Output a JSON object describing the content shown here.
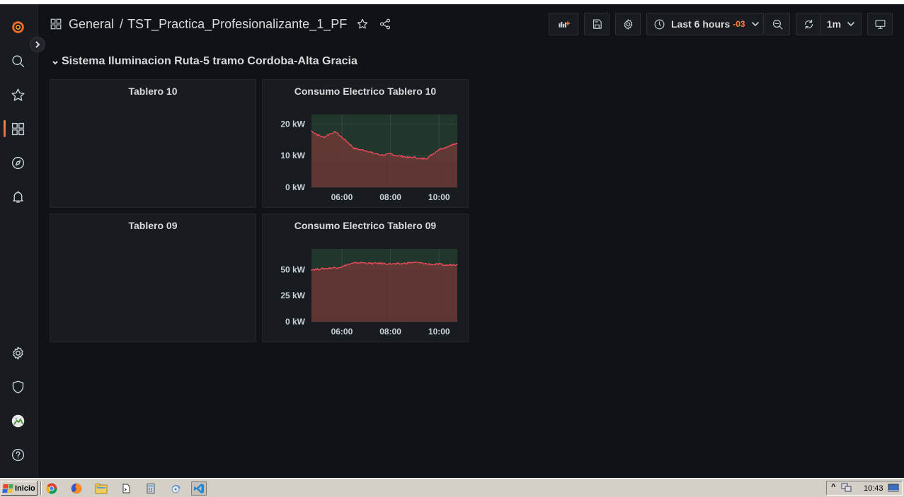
{
  "breadcrumb": {
    "folder": "General",
    "separator": "/",
    "dashboard": "TST_Practica_Profesionalizante_1_PF"
  },
  "toolbar": {
    "time_range": "Last 6 hours",
    "timezone": "-03",
    "refresh_interval": "1m"
  },
  "row": {
    "title": "Sistema Iluminacion Ruta-5 tramo Cordoba-Alta Gracia"
  },
  "panels": [
    {
      "title": "Tablero 10"
    },
    {
      "title": "Consumo Electrico Tablero 10"
    },
    {
      "title": "Tablero 09"
    },
    {
      "title": "Consumo Electrico Tablero 09"
    }
  ],
  "colors": {
    "line": "#f2495c",
    "fill": "#6b3a37",
    "threshold_bg": "#22372c",
    "accent": "#ff7f3f"
  },
  "chart_data": [
    {
      "type": "area",
      "title": "Consumo Electrico Tablero 10",
      "x_ticks": [
        "06:00",
        "08:00",
        "10:00"
      ],
      "y_ticks": [
        "0 kW",
        "10 kW",
        "20 kW"
      ],
      "ylim": [
        0,
        23
      ],
      "threshold": 8,
      "x": [
        "04:45",
        "05:00",
        "05:15",
        "05:30",
        "05:45",
        "06:00",
        "06:15",
        "06:30",
        "06:45",
        "07:00",
        "07:15",
        "07:30",
        "07:45",
        "08:00",
        "08:15",
        "08:30",
        "08:45",
        "09:00",
        "09:15",
        "09:30",
        "09:45",
        "10:00",
        "10:15",
        "10:30",
        "10:45"
      ],
      "series": [
        {
          "values": [
            17.8,
            16.6,
            15.8,
            16.9,
            17.5,
            15.8,
            14.2,
            12.4,
            11.9,
            11.6,
            10.9,
            10.4,
            10.2,
            10.6,
            10.0,
            9.8,
            9.4,
            9.5,
            9.0,
            9.2,
            10.6,
            12.0,
            12.6,
            13.4,
            13.8
          ]
        }
      ]
    },
    {
      "type": "area",
      "title": "Consumo Electrico Tablero 09",
      "x_ticks": [
        "06:00",
        "08:00",
        "10:00"
      ],
      "y_ticks": [
        "0 kW",
        "25 kW",
        "50 kW"
      ],
      "ylim": [
        0,
        70
      ],
      "threshold": 50,
      "x": [
        "04:45",
        "05:00",
        "05:15",
        "05:30",
        "05:45",
        "06:00",
        "06:15",
        "06:30",
        "06:45",
        "07:00",
        "07:15",
        "07:30",
        "07:45",
        "08:00",
        "08:15",
        "08:30",
        "08:45",
        "09:00",
        "09:15",
        "09:30",
        "09:45",
        "10:00",
        "10:15",
        "10:30",
        "10:45"
      ],
      "series": [
        {
          "values": [
            50.0,
            50.4,
            51.0,
            51.5,
            52.0,
            52.8,
            55.0,
            56.2,
            56.8,
            56.4,
            56.0,
            56.2,
            55.8,
            55.6,
            55.4,
            55.8,
            56.6,
            57.0,
            56.4,
            55.6,
            55.0,
            55.2,
            54.2,
            54.6,
            55.2
          ]
        }
      ]
    }
  ],
  "taskbar": {
    "start_label": "Inicio",
    "clock": "10:43"
  }
}
